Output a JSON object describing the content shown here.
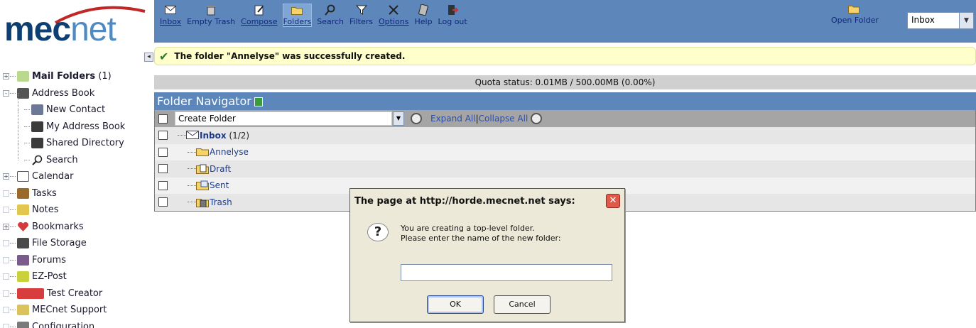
{
  "logo": {
    "text_a": "mec",
    "text_b": "net"
  },
  "toolbar": {
    "items": [
      {
        "label": "Inbox",
        "icon": "envelope-icon"
      },
      {
        "label": "Empty Trash",
        "icon": "trash-icon"
      },
      {
        "label": "Compose",
        "icon": "compose-icon"
      },
      {
        "label": "Folders",
        "icon": "folder-icon"
      },
      {
        "label": "Search",
        "icon": "search-icon"
      },
      {
        "label": "Filters",
        "icon": "filter-icon"
      },
      {
        "label": "Options",
        "icon": "tools-icon"
      },
      {
        "label": "Help",
        "icon": "help-icon"
      },
      {
        "label": "Log out",
        "icon": "logout-icon"
      }
    ],
    "open_folder_label": "Open Folder",
    "folder_select_value": "Inbox"
  },
  "sidebar": {
    "items": [
      {
        "label": "Mail Folders",
        "count": "(1)",
        "exp": "+"
      },
      {
        "label": "Address Book",
        "exp": "-"
      },
      {
        "label": "New Contact"
      },
      {
        "label": "My Address Book"
      },
      {
        "label": "Shared Directory"
      },
      {
        "label": "Search"
      },
      {
        "label": "Calendar",
        "exp": "+"
      },
      {
        "label": "Tasks"
      },
      {
        "label": "Notes"
      },
      {
        "label": "Bookmarks",
        "exp": "+"
      },
      {
        "label": "File Storage"
      },
      {
        "label": "Forums"
      },
      {
        "label": "EZ-Post"
      },
      {
        "label": "Test Creator"
      },
      {
        "label": "MECnet Support"
      },
      {
        "label": "Configuration"
      }
    ]
  },
  "notice": {
    "text": "The folder \"Annelyse\" was successfully created."
  },
  "quota": {
    "text": "Quota status: 0.01MB / 500.00MB (0.00%)"
  },
  "navigator": {
    "title": "Folder Navigator",
    "action_select_value": "Create Folder",
    "expand_all": "Expand All",
    "separator": "|",
    "collapse_all": "Collapse All",
    "folders": [
      {
        "label": "Inbox",
        "count": "(1/2)"
      },
      {
        "label": "Annelyse"
      },
      {
        "label": "Draft"
      },
      {
        "label": "Sent"
      },
      {
        "label": "Trash"
      }
    ]
  },
  "dialog": {
    "title": "The page at http://horde.mecnet.net says:",
    "message_line1": "You are creating a top-level folder.",
    "message_line2": "Please enter the name of the new folder:",
    "input_value": "",
    "ok_label": "OK",
    "cancel_label": "Cancel"
  },
  "colors": {
    "toolbar_bg": "#5d87ba",
    "notice_bg": "#ffffcc",
    "quota_bg": "#d0d0d0",
    "link": "#2a4fa8"
  }
}
